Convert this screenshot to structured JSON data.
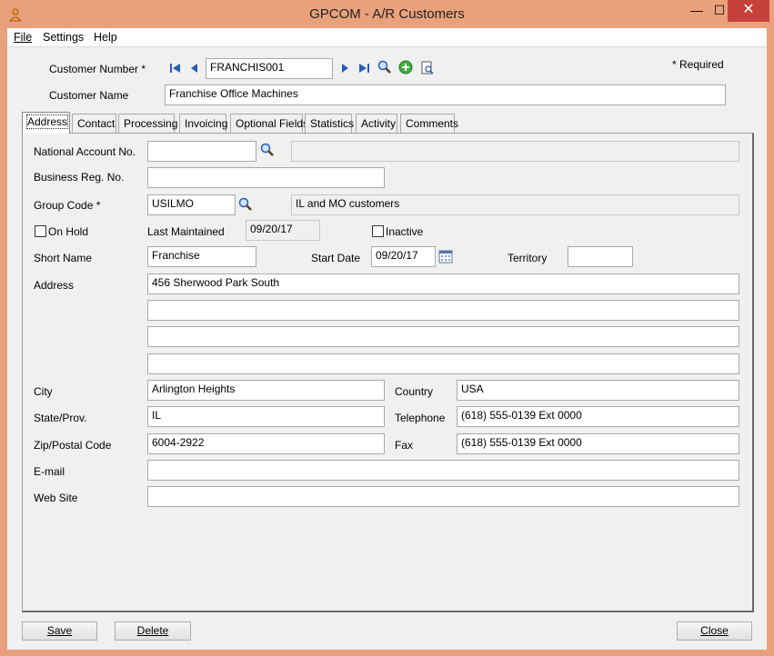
{
  "window": {
    "title": "GPCOM - A/R Customers",
    "minimize": "—",
    "maximize": "☐",
    "close": "✕"
  },
  "menu": {
    "file": "File",
    "settings": "Settings",
    "help": "Help"
  },
  "header": {
    "customer_number_label": "Customer Number *",
    "customer_number_value": "FRANCHIS001",
    "customer_name_label": "Customer Name",
    "customer_name_value": "Franchise Office Machines",
    "required_note": "*  Required"
  },
  "tabs": [
    "Address",
    "Contact",
    "Processing",
    "Invoicing",
    "Optional Fields",
    "Statistics",
    "Activity",
    "Comments"
  ],
  "address": {
    "national_account_label": "National Account No.",
    "national_account_value": "",
    "national_account_desc": "",
    "business_reg_label": "Business Reg. No.",
    "business_reg_value": "",
    "group_code_label": "Group Code *",
    "group_code_value": "USILMO",
    "group_code_desc": "IL and MO customers",
    "on_hold_label": "On Hold",
    "last_maintained_label": "Last Maintained",
    "last_maintained_value": "09/20/17",
    "inactive_label": "Inactive",
    "short_name_label": "Short Name",
    "short_name_value": "Franchise",
    "start_date_label": "Start Date",
    "start_date_value": "09/20/17",
    "territory_label": "Territory",
    "territory_value": "",
    "address_label": "Address",
    "address_lines": [
      "456 Sherwood Park South",
      "",
      "",
      ""
    ],
    "city_label": "City",
    "city_value": "Arlington Heights",
    "country_label": "Country",
    "country_value": "USA",
    "state_label": "State/Prov.",
    "state_value": "IL",
    "telephone_label": "Telephone",
    "telephone_value": "(618) 555-0139 Ext 0000",
    "zip_label": "Zip/Postal Code",
    "zip_value": "6004-2922",
    "fax_label": "Fax",
    "fax_value": "(618) 555-0139 Ext 0000",
    "email_label": "E-mail",
    "email_value": "",
    "website_label": "Web Site",
    "website_value": ""
  },
  "buttons": {
    "save": "Save",
    "delete": "Delete",
    "close": "Close"
  }
}
